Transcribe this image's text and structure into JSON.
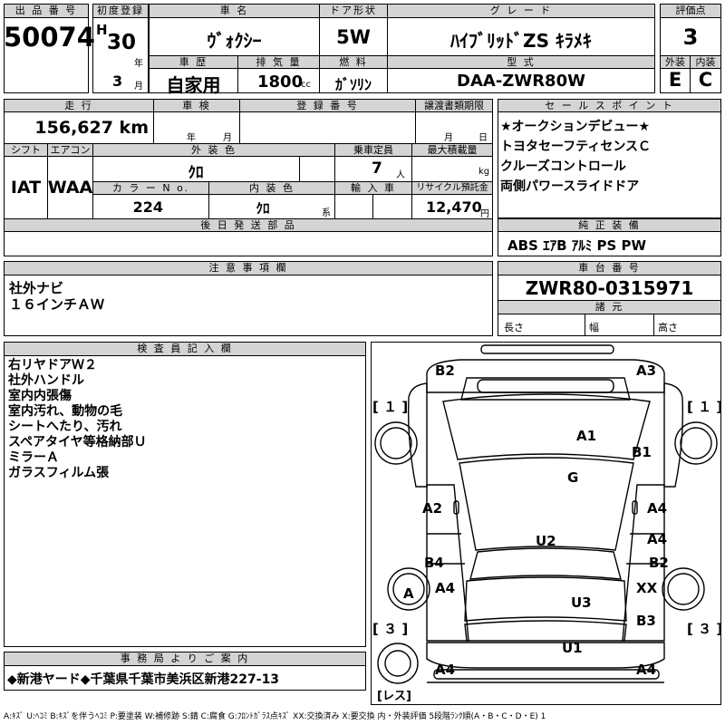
{
  "headers": {
    "lot_no": "出 品 番 号",
    "first_reg": "初度登録",
    "car_name": "車 名",
    "doors": "ドア形状",
    "grade": "グ レ ー ド",
    "score": "評価点",
    "car_history": "車 歴",
    "displacement": "排 気 量",
    "fuel": "燃 料",
    "model_code": "型 式",
    "exterior": "外装",
    "interior": "内装",
    "mileage": "走 行",
    "inspection": "車 検",
    "reg_no": "登 録 番 号",
    "transfer_deadline": "譲渡書類期限",
    "sales_points": "セ ー ル ス ポ イ ン ト",
    "shift": "シフト",
    "aircon": "エアコン",
    "ext_color": "外 装 色",
    "capacity": "乗車定員",
    "max_load": "最大積載量",
    "color_no": "カ ラ ー N o.",
    "int_color": "内 装 色",
    "import": "輸 入 車",
    "recycle": "リサイクル預託金",
    "later_parts": "後 日 発 送 部 品",
    "genuine_equip": "純 正 装 備",
    "notes": "注 意 事 項 欄",
    "chassis_no": "車 台 番 号",
    "dimensions": "諸 元",
    "inspector": "検 査 員 記 入 欄",
    "office": "事 務 局 よ り ご 案 内"
  },
  "lot_no": "50074",
  "era": "H",
  "reg_year": "30",
  "reg_month": "3",
  "unit_year": "年",
  "unit_month": "月",
  "car_name": "ｳﾞｫｸｼｰ",
  "doors": "5W",
  "grade": "ﾊｲﾌﾞﾘｯﾄﾞZS ｷﾗﾒｷ",
  "score": "3",
  "car_history": "自家用",
  "displacement": "1800",
  "displacement_unit": "cc",
  "fuel": "ｶﾞｿﾘﾝ",
  "model_code": "DAA-ZWR80W",
  "exterior_grade": "E",
  "interior_grade": "C",
  "mileage": "156,627 km",
  "inspection_year_unit": "年",
  "inspection_month_unit": "月",
  "transfer_month_unit": "月",
  "transfer_day_unit": "日",
  "sales_points": [
    "★オークションデビュー★",
    "トヨタセーフティセンスＣ",
    "クルーズコントロール",
    "両側パワースライドドア"
  ],
  "shift": "IAT",
  "aircon": "WAA",
  "ext_color": "ｸﾛ",
  "capacity": "7",
  "capacity_unit": "人",
  "max_load_unit": "kg",
  "color_no": "224",
  "int_color": "ｸﾛ",
  "int_color_unit": "系",
  "recycle": "12,470",
  "recycle_unit": "円",
  "genuine_equip": "ABS ｴｱB ｱﾙﾐ PS PW",
  "notes": [
    "社外ナビ",
    "１６インチＡＷ"
  ],
  "chassis_no": "ZWR80-0315971",
  "dim_length": "長さ",
  "dim_width": "幅",
  "dim_height": "高さ",
  "inspector_notes": [
    "右リヤドアＷ２",
    "社外ハンドル",
    "室内内張傷",
    "室内汚れ、動物の毛",
    "シートへたり、汚れ",
    "スペアタイヤ等格納部Ｕ",
    "ミラーＡ",
    "ガラスフィルム張"
  ],
  "diagram": {
    "tire_fl": "１",
    "tire_fr": "１",
    "tire_rl": "３",
    "tire_rr": "３",
    "spare": "レス",
    "marks": {
      "b2_front": "B2",
      "a3": "A3",
      "a1": "A1",
      "b1": "B1",
      "g": "G",
      "a2": "A2",
      "a4_right1": "A4",
      "a4_right2": "A4",
      "u2": "U2",
      "b4": "B4",
      "b2_right": "B2",
      "a4_left_mid": "A4",
      "a_mirror": "A",
      "xx": "XX",
      "u3": "U3",
      "b3": "B3",
      "u1": "U1",
      "a4_bl": "A4",
      "a4_br": "A4"
    }
  },
  "office_notice": "◆新港ヤード◆千葉県千葉市美浜区新港227-13",
  "legend": "A:ｷｽﾞ U:ﾍｺﾐ B:ｷｽﾞを伴うﾍｺﾐ P:要塗装 W:補修跡 S:錆 C:腐食 G:ﾌﾛﾝﾄｶﾞﾗｽ点ｷｽﾞ XX:交換済み X:要交換  内・外装評価 5段階ﾗﾝｸ順(A・B・C・D・E) 1"
}
